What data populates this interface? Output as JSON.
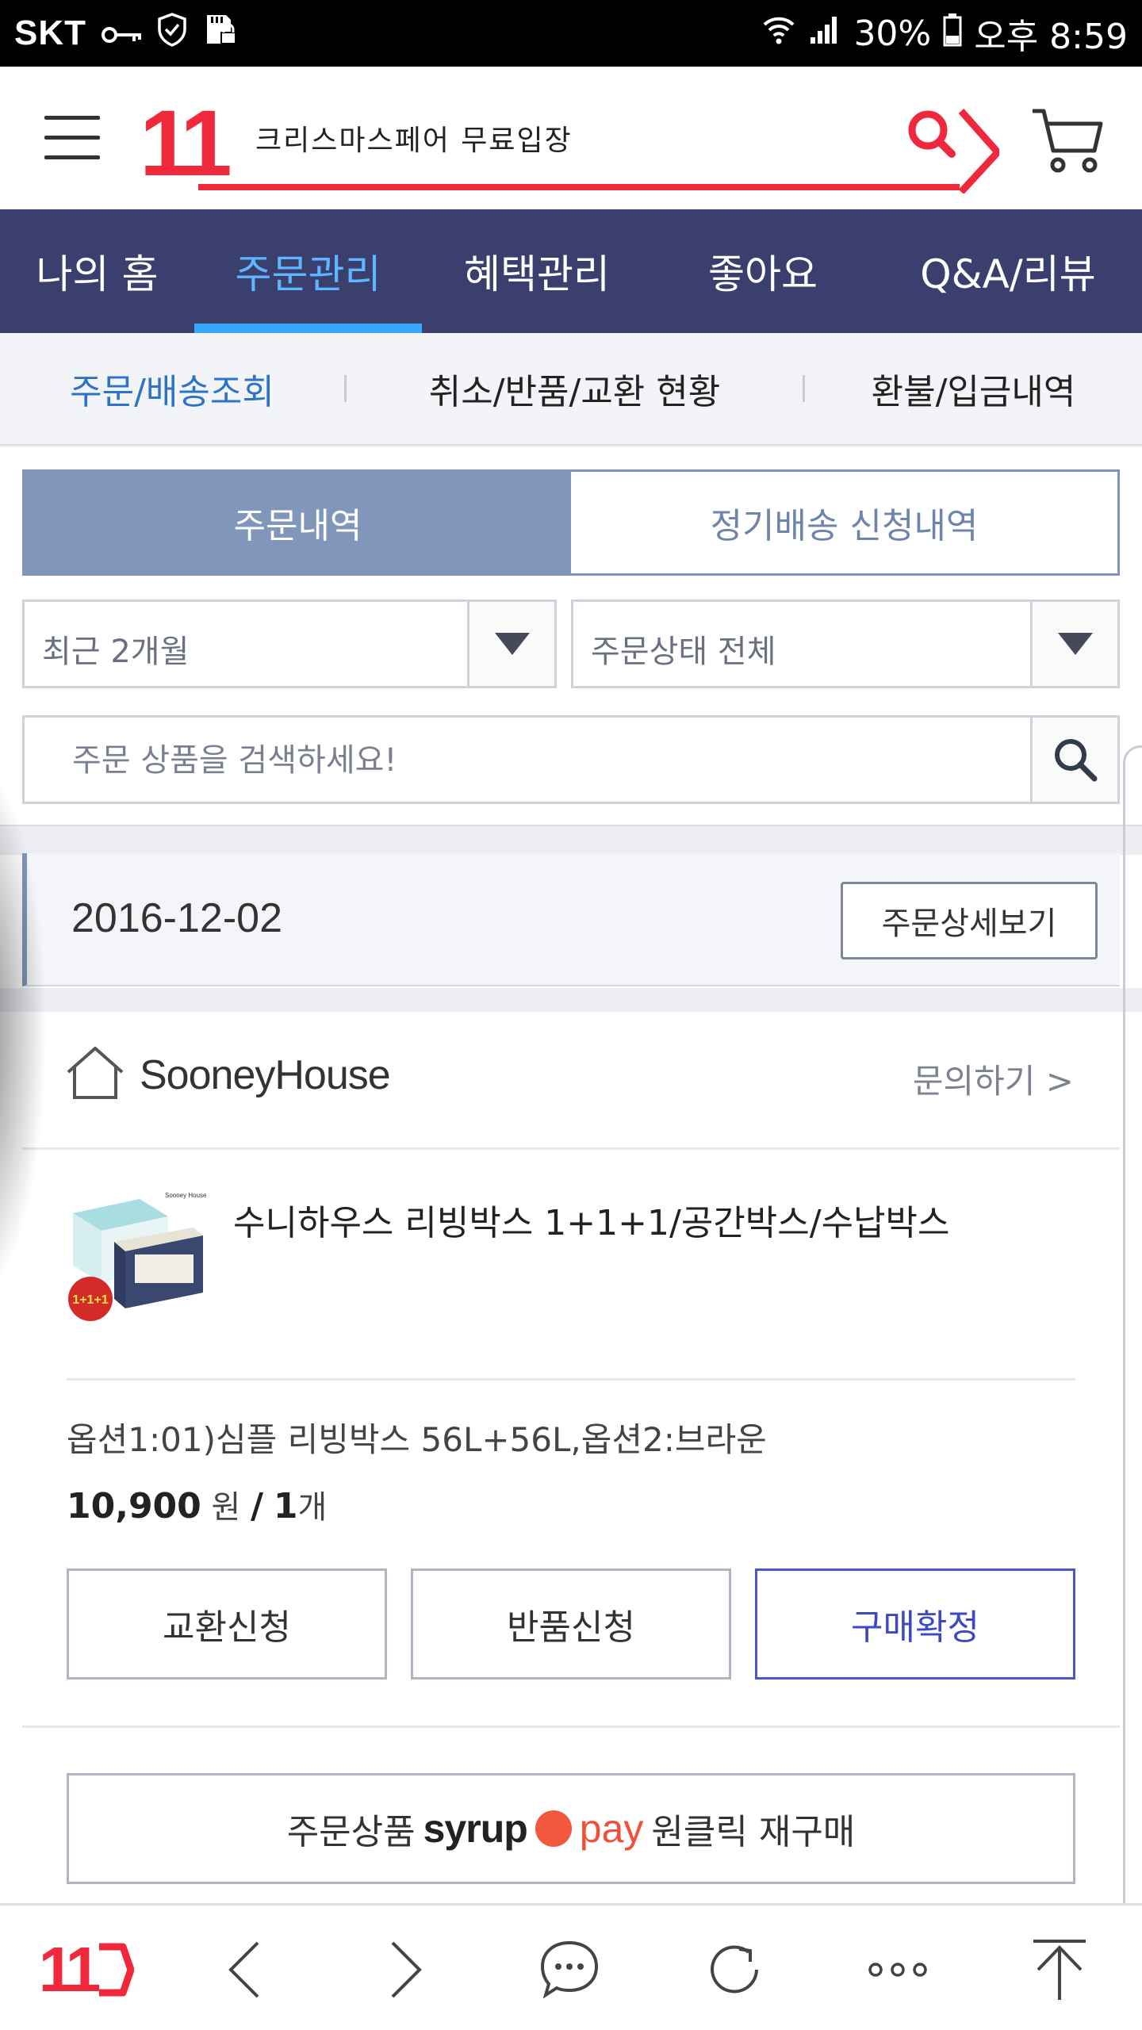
{
  "status_bar": {
    "carrier": "SKT",
    "battery": "30%",
    "time": "오후 8:59"
  },
  "header": {
    "logo": "11",
    "search_text": "크리스마스페어 무료입장"
  },
  "main_nav": {
    "tabs": [
      {
        "label": "나의 홈",
        "active": false
      },
      {
        "label": "주문관리",
        "active": true
      },
      {
        "label": "혜택관리",
        "active": false
      },
      {
        "label": "좋아요",
        "active": false
      },
      {
        "label": "Q&A/리뷰",
        "active": false
      }
    ]
  },
  "sub_nav": {
    "items": [
      {
        "label": "주문/배송조회",
        "active": true
      },
      {
        "label": "취소/반품/교환 현황",
        "active": false
      },
      {
        "label": "환불/입금내역",
        "active": false
      }
    ]
  },
  "segment": {
    "order_history": "주문내역",
    "subscription_history": "정기배송 신청내역"
  },
  "filters": {
    "period": "최근 2개월",
    "status": "주문상태 전체"
  },
  "order_search": {
    "placeholder": "주문 상품을 검색하세요!"
  },
  "order": {
    "date": "2016-12-02",
    "detail_button": "주문상세보기",
    "shop_name": "SooneyHouse",
    "inquiry": "문의하기 >",
    "product_name": "수니하우스 리빙박스 1+1+1/공간박스/수납박스",
    "thumb_badge": "1+1+1",
    "thumb_brand": "Sooney House",
    "option": "옵션1:01)심플 리빙박스 56L+56L,옵션2:브라운",
    "price": "10,900",
    "price_unit": "원",
    "quantity": "1",
    "quantity_unit": "개",
    "buttons": {
      "exchange": "교환신청",
      "return": "반품신청",
      "confirm": "구매확정"
    },
    "repurchase": {
      "prefix": "주문상품",
      "syrup": "syrup",
      "pay": "pay",
      "suffix": "원클릭 재구매"
    }
  },
  "bottom_bar": {
    "logo": "11"
  },
  "colors": {
    "brand_red": "#f0283c",
    "nav_bg": "#3b3f6d",
    "active_tab": "#5db6ff",
    "segment_active": "#8096ba",
    "primary_button": "#4a55c7"
  }
}
